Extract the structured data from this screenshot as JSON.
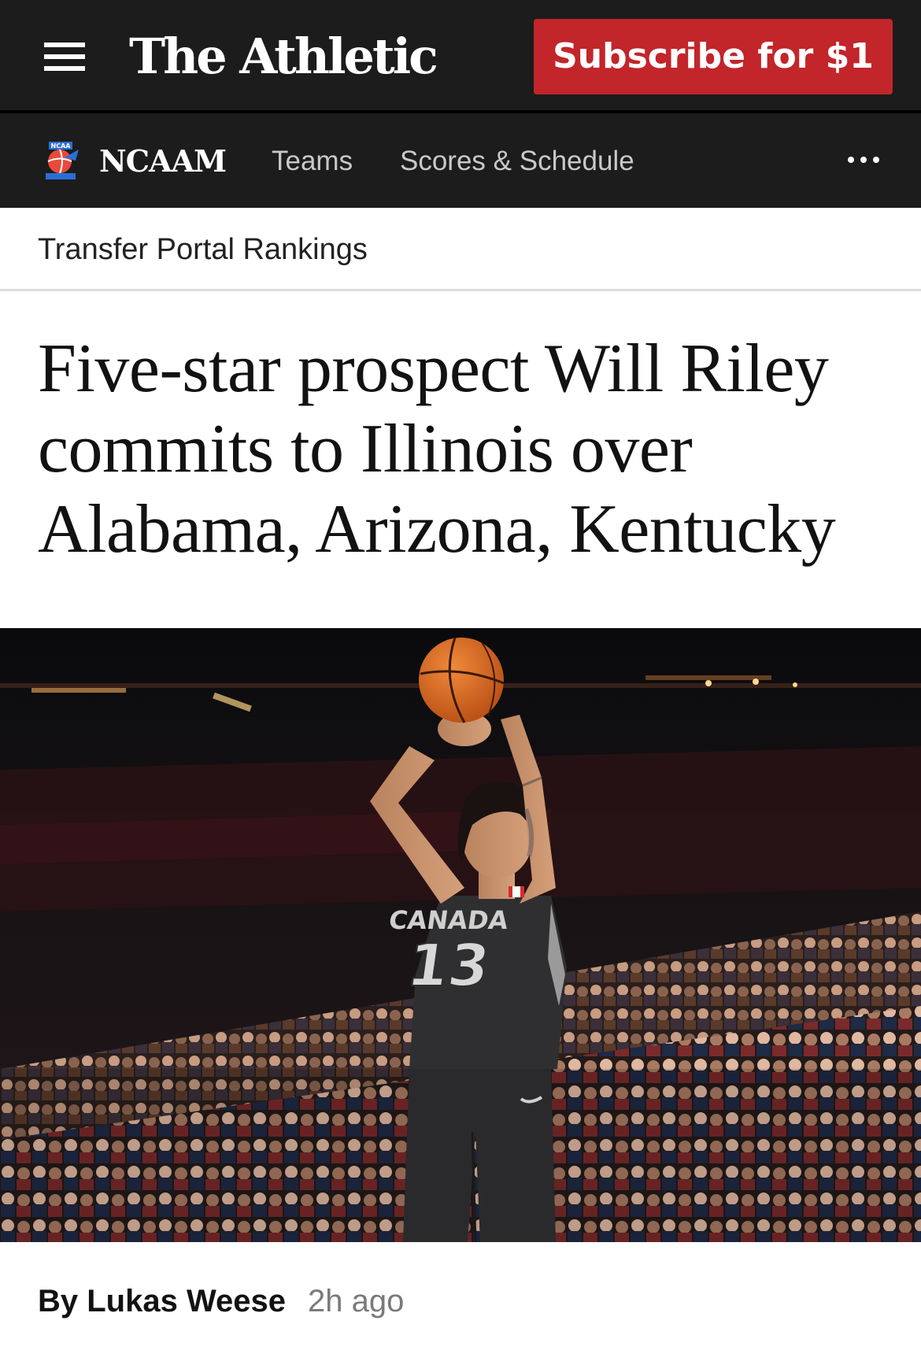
{
  "header": {
    "logo_text": "The Athletic",
    "subscribe_label": "Subscribe for $1",
    "menu_icon": "hamburger-menu-icon",
    "colors": {
      "background": "#1c1c1c",
      "subscribe_button": "#c2252a"
    }
  },
  "subnav": {
    "league": "NCAAM",
    "league_icon": "ncaa-basketball-logo-icon",
    "links": [
      "Teams",
      "Scores & Schedule"
    ],
    "more_icon": "more-dots-icon"
  },
  "breadcrumb": "Transfer Portal Rankings",
  "article": {
    "headline": "Five-star prospect Will Riley commits to Illinois over Alabama, Arizona, Kentucky",
    "hero_image": {
      "jersey_text": "CANADA",
      "jersey_number": "13"
    },
    "byline": {
      "author": "By Lukas Weese",
      "time": "2h ago"
    }
  }
}
